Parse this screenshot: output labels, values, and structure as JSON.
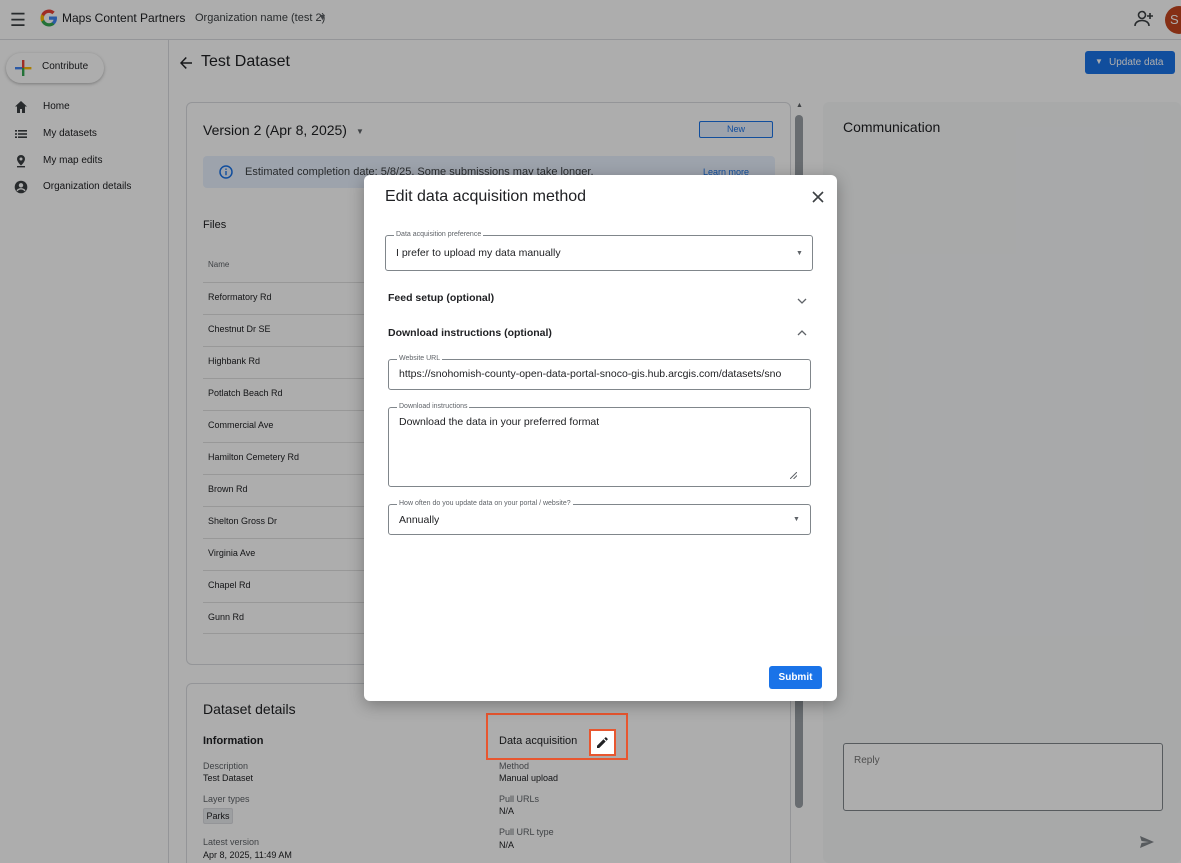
{
  "topbar": {
    "app_name": "Maps Content Partners",
    "org_name": "Organization name (test 2)",
    "avatar_letter": "S"
  },
  "sidebar": {
    "contribute_label": "Contribute",
    "items": [
      {
        "label": "Home",
        "icon": "home-icon"
      },
      {
        "label": "My datasets",
        "icon": "list-icon"
      },
      {
        "label": "My map edits",
        "icon": "map-pin-icon"
      },
      {
        "label": "Organization details",
        "icon": "account-circle-icon"
      }
    ]
  },
  "page": {
    "title": "Test Dataset",
    "update_button": "Update data"
  },
  "version": {
    "label": "Version 2 (Apr 8, 2025)",
    "badge": "New",
    "info_text": "Estimated completion date: 5/8/25. Some submissions may take longer.",
    "learn_more": "Learn more"
  },
  "files": {
    "heading": "Files",
    "column_name": "Name",
    "rows": [
      "Reformatory Rd",
      "Chestnut Dr SE",
      "Highbank Rd",
      "Potlatch Beach Rd",
      "Commercial Ave",
      "Hamilton Cemetery Rd",
      "Brown Rd",
      "Shelton Gross Dr",
      "Virginia Ave",
      "Chapel Rd",
      "Gunn Rd"
    ]
  },
  "details": {
    "heading": "Dataset details",
    "information_heading": "Information",
    "description_label": "Description",
    "description_value": "Test Dataset",
    "layer_types_label": "Layer types",
    "layer_type_chip": "Parks",
    "latest_version_label": "Latest version",
    "latest_version_value": "Apr 8, 2025, 11:49 AM",
    "acquisition_heading": "Data acquisition",
    "method_label": "Method",
    "method_value": "Manual upload",
    "pull_urls_label": "Pull URLs",
    "pull_urls_value": "N/A",
    "pull_url_type_label": "Pull URL type",
    "pull_url_type_value": "N/A"
  },
  "communication": {
    "heading": "Communication",
    "reply_placeholder": "Reply"
  },
  "dialog": {
    "title": "Edit data acquisition method",
    "preference_label": "Data acquisition preference",
    "preference_value": "I prefer to upload my data manually",
    "feed_setup": "Feed setup (optional)",
    "download_instructions_section": "Download instructions (optional)",
    "website_url_label": "Website URL",
    "website_url_value": "https://snohomish-county-open-data-portal-snoco-gis.hub.arcgis.com/datasets/sno",
    "download_instructions_label": "Download instructions",
    "download_instructions_value": "Download the data in your preferred format",
    "frequency_label": "How often do you update data on your portal / website?",
    "frequency_value": "Annually",
    "submit": "Submit"
  }
}
